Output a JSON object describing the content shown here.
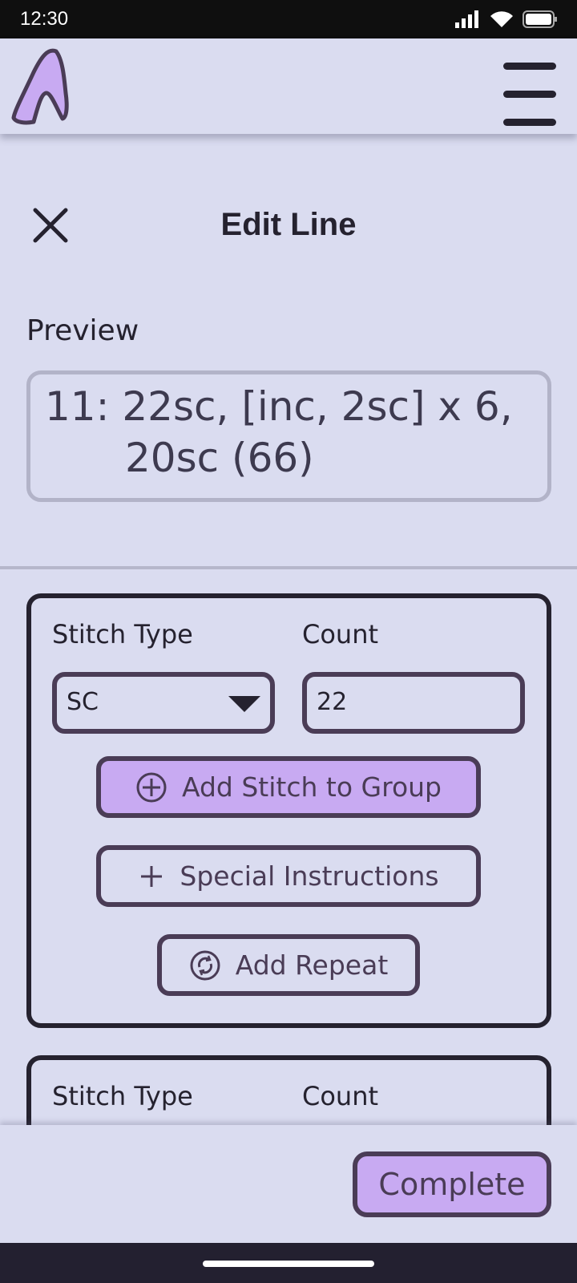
{
  "status_bar": {
    "time": "12:30"
  },
  "header": {
    "logo": "app-logo",
    "menu_icon": "hamburger-icon"
  },
  "dialog": {
    "title": "Edit Line",
    "close_icon": "close-icon"
  },
  "preview": {
    "label": "Preview",
    "line1": "11: 22sc, [inc, 2sc] x 6,",
    "line2": "20sc (66)"
  },
  "groups": [
    {
      "stitch_type_label": "Stitch Type",
      "count_label": "Count",
      "stitch_type_value": "SC",
      "count_value": "22",
      "add_stitch_label": "Add Stitch to Group",
      "special_label": "Special Instructions",
      "repeat_label": "Add Repeat"
    },
    {
      "stitch_type_label": "Stitch Type",
      "count_label": "Count"
    }
  ],
  "footer": {
    "complete_label": "Complete"
  },
  "colors": {
    "accent": "#c8aaf2",
    "background": "#dadcf0",
    "border": "#4a3c56",
    "text": "#25222f"
  }
}
